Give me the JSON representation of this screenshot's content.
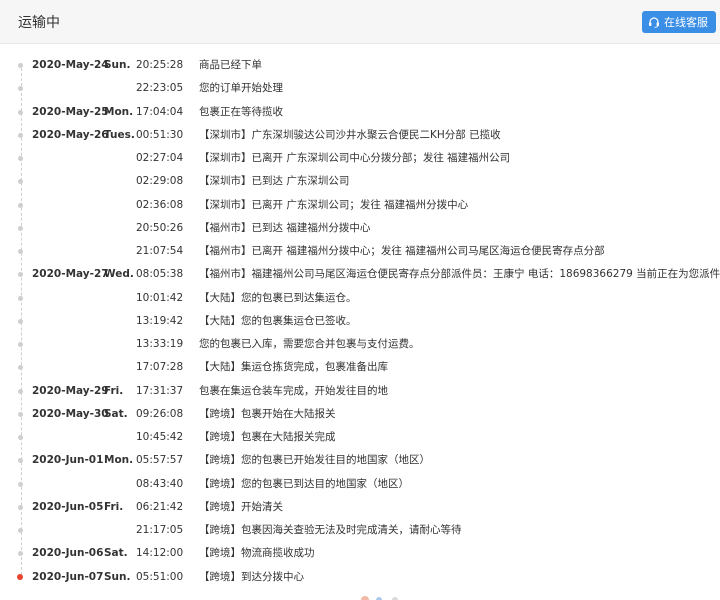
{
  "header": {
    "title": "运输中",
    "service_button": "在线客服"
  },
  "events": [
    {
      "date": "2020-May-24",
      "day": "Sun.",
      "time": "20:25:28",
      "desc": "商品已经下单"
    },
    {
      "date": "",
      "day": "",
      "time": "22:23:05",
      "desc": "您的订单开始处理"
    },
    {
      "date": "2020-May-25",
      "day": "Mon.",
      "time": "17:04:04",
      "desc": "包裹正在等待揽收"
    },
    {
      "date": "2020-May-26",
      "day": "Tues.",
      "time": "00:51:30",
      "desc": "【深圳市】广东深圳骏达公司沙井水聚云合便民二KH分部 已揽收"
    },
    {
      "date": "",
      "day": "",
      "time": "02:27:04",
      "desc": "【深圳市】已离开 广东深圳公司中心分拨分部；发往 福建福州公司"
    },
    {
      "date": "",
      "day": "",
      "time": "02:29:08",
      "desc": "【深圳市】已到达 广东深圳公司"
    },
    {
      "date": "",
      "day": "",
      "time": "02:36:08",
      "desc": "【深圳市】已离开 广东深圳公司；发往 福建福州分拨中心"
    },
    {
      "date": "",
      "day": "",
      "time": "20:50:26",
      "desc": "【福州市】已到达 福建福州分拨中心"
    },
    {
      "date": "",
      "day": "",
      "time": "21:07:54",
      "desc": "【福州市】已离开 福建福州分拨中心；发往 福建福州公司马尾区海运仓便民寄存点分部"
    },
    {
      "date": "2020-May-27",
      "day": "Wed.",
      "time": "08:05:38",
      "desc": "【福州市】福建福州公司马尾区海运仓便民寄存点分部派件员：王康宁 电话：18698366279 当前正在为您派件"
    },
    {
      "date": "",
      "day": "",
      "time": "10:01:42",
      "desc": "【大陆】您的包裹已到达集运仓。"
    },
    {
      "date": "",
      "day": "",
      "time": "13:19:42",
      "desc": "【大陆】您的包裹集运仓已签收。"
    },
    {
      "date": "",
      "day": "",
      "time": "13:33:19",
      "desc": "您的包裹已入库，需要您合并包裹与支付运费。"
    },
    {
      "date": "",
      "day": "",
      "time": "17:07:28",
      "desc": "【大陆】集运仓拣货完成，包裹准备出库"
    },
    {
      "date": "2020-May-29",
      "day": "Fri.",
      "time": "17:31:37",
      "desc": "包裹在集运仓装车完成，开始发往目的地"
    },
    {
      "date": "2020-May-30",
      "day": "Sat.",
      "time": "09:26:08",
      "desc": "【跨境】包裹开始在大陆报关"
    },
    {
      "date": "",
      "day": "",
      "time": "10:45:42",
      "desc": "【跨境】包裹在大陆报关完成"
    },
    {
      "date": "2020-Jun-01",
      "day": "Mon.",
      "time": "05:57:57",
      "desc": "【跨境】您的包裹已开始发往目的地国家（地区）"
    },
    {
      "date": "",
      "day": "",
      "time": "08:43:40",
      "desc": "【跨境】您的包裹已到达目的地国家（地区）"
    },
    {
      "date": "2020-Jun-05",
      "day": "Fri.",
      "time": "06:21:42",
      "desc": "【跨境】开始清关"
    },
    {
      "date": "",
      "day": "",
      "time": "21:17:05",
      "desc": "【跨境】包裹因海关查验无法及时完成清关，请耐心等待"
    },
    {
      "date": "2020-Jun-06",
      "day": "Sat.",
      "time": "14:12:00",
      "desc": "【跨境】物流商揽收成功"
    },
    {
      "date": "2020-Jun-07",
      "day": "Sun.",
      "time": "05:51:00",
      "desc": "【跨境】到达分拨中心"
    }
  ],
  "colors": {
    "accent": "#3a8ee6",
    "current_dot": "#e8452e",
    "dot": "#cfcfcf"
  }
}
